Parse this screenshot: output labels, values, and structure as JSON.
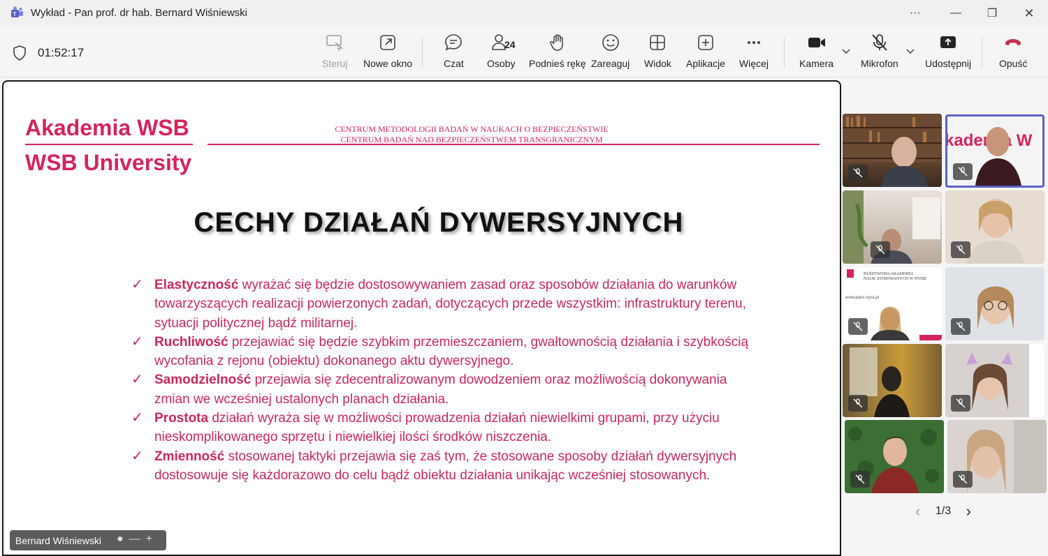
{
  "window": {
    "title": "Wykład - Pan prof. dr hab. Bernard Wiśniewski",
    "more": "···",
    "minimize": "—",
    "restore": "❐",
    "close": "✕"
  },
  "toolbar": {
    "timer": "01:52:17",
    "people_count": "24",
    "buttons": {
      "steruj": "Steruj",
      "nowe_okno": "Nowe okno",
      "czat": "Czat",
      "osoby": "Osoby",
      "podnies": "Podnieś rękę",
      "zareaguj": "Zareaguj",
      "widok": "Widok",
      "aplikacje": "Aplikacje",
      "wiecej": "Więcej",
      "kamera": "Kamera",
      "mikrofon": "Mikrofon",
      "udostepnij": "Udostępnij",
      "opusc": "Opuść"
    },
    "colors": {
      "leave": "#c4314b",
      "accent": "#5b5fc7"
    }
  },
  "slide": {
    "logo_line1": "Akademia WSB",
    "logo_line2": "WSB University",
    "header_line1": "CENTRUM METODOLOGII BADAŃ W NAUKACH O BEZPIECZEŃSTWIE",
    "header_line2": "CENTRUM BADAŃ NAD BEZPIECZEŃSTWEM TRANSGRANICZNYM",
    "heading": "CECHY DZIAŁAŃ DYWERSYJNYCH",
    "check": "✓",
    "bullets": [
      {
        "term": "Elastyczność",
        "text": " wyrażać się będzie dostosowywaniem zasad oraz sposobów działania do warunków towarzyszących realizacji powierzonych zadań, dotyczących przede wszystkim: infrastruktury terenu, sytuacji politycznej bądź militarnej."
      },
      {
        "term": "Ruchliwość",
        "text": " przejawiać się będzie szybkim przemieszczaniem, gwałtownością działania i szybkością wycofania z rejonu (obiektu) dokonanego aktu dywersyjnego."
      },
      {
        "term": "Samodzielność",
        "text": " przejawia się zdecentralizowanym dowodzeniem oraz możliwością dokonywania zmian we wcześniej ustalonych planach działania."
      },
      {
        "term": "Prostota",
        "text": " działań wyraża się w możliwości prowadzenia działań niewielkimi grupami, przy użyciu nieskomplikowanego sprzętu i niewielkiej ilości środków niszczenia."
      },
      {
        "term": "Zmienność",
        "text": " stosowanej taktyki  przejawia się zaś tym, że stosowane sposoby działań dywersyjnych dostosowuje się każdorazowo do celu bądź obiektu działania unikając wcześniej stosowanych."
      }
    ],
    "color": "#d4245e"
  },
  "presenter": {
    "name": "Bernard Wiśniewski",
    "minus": "—",
    "plus": "+"
  },
  "gallery": {
    "page": "1/3",
    "prev": "‹",
    "next": "›",
    "tile_text_logo": "kademia W",
    "tile_text_pans1": "PAŃSTWOWA AKADEMIA",
    "tile_text_pans2": "NAUK STOSOWANYCH W NYSIE",
    "tile_text_url": "www.pans.nysa.pl"
  }
}
